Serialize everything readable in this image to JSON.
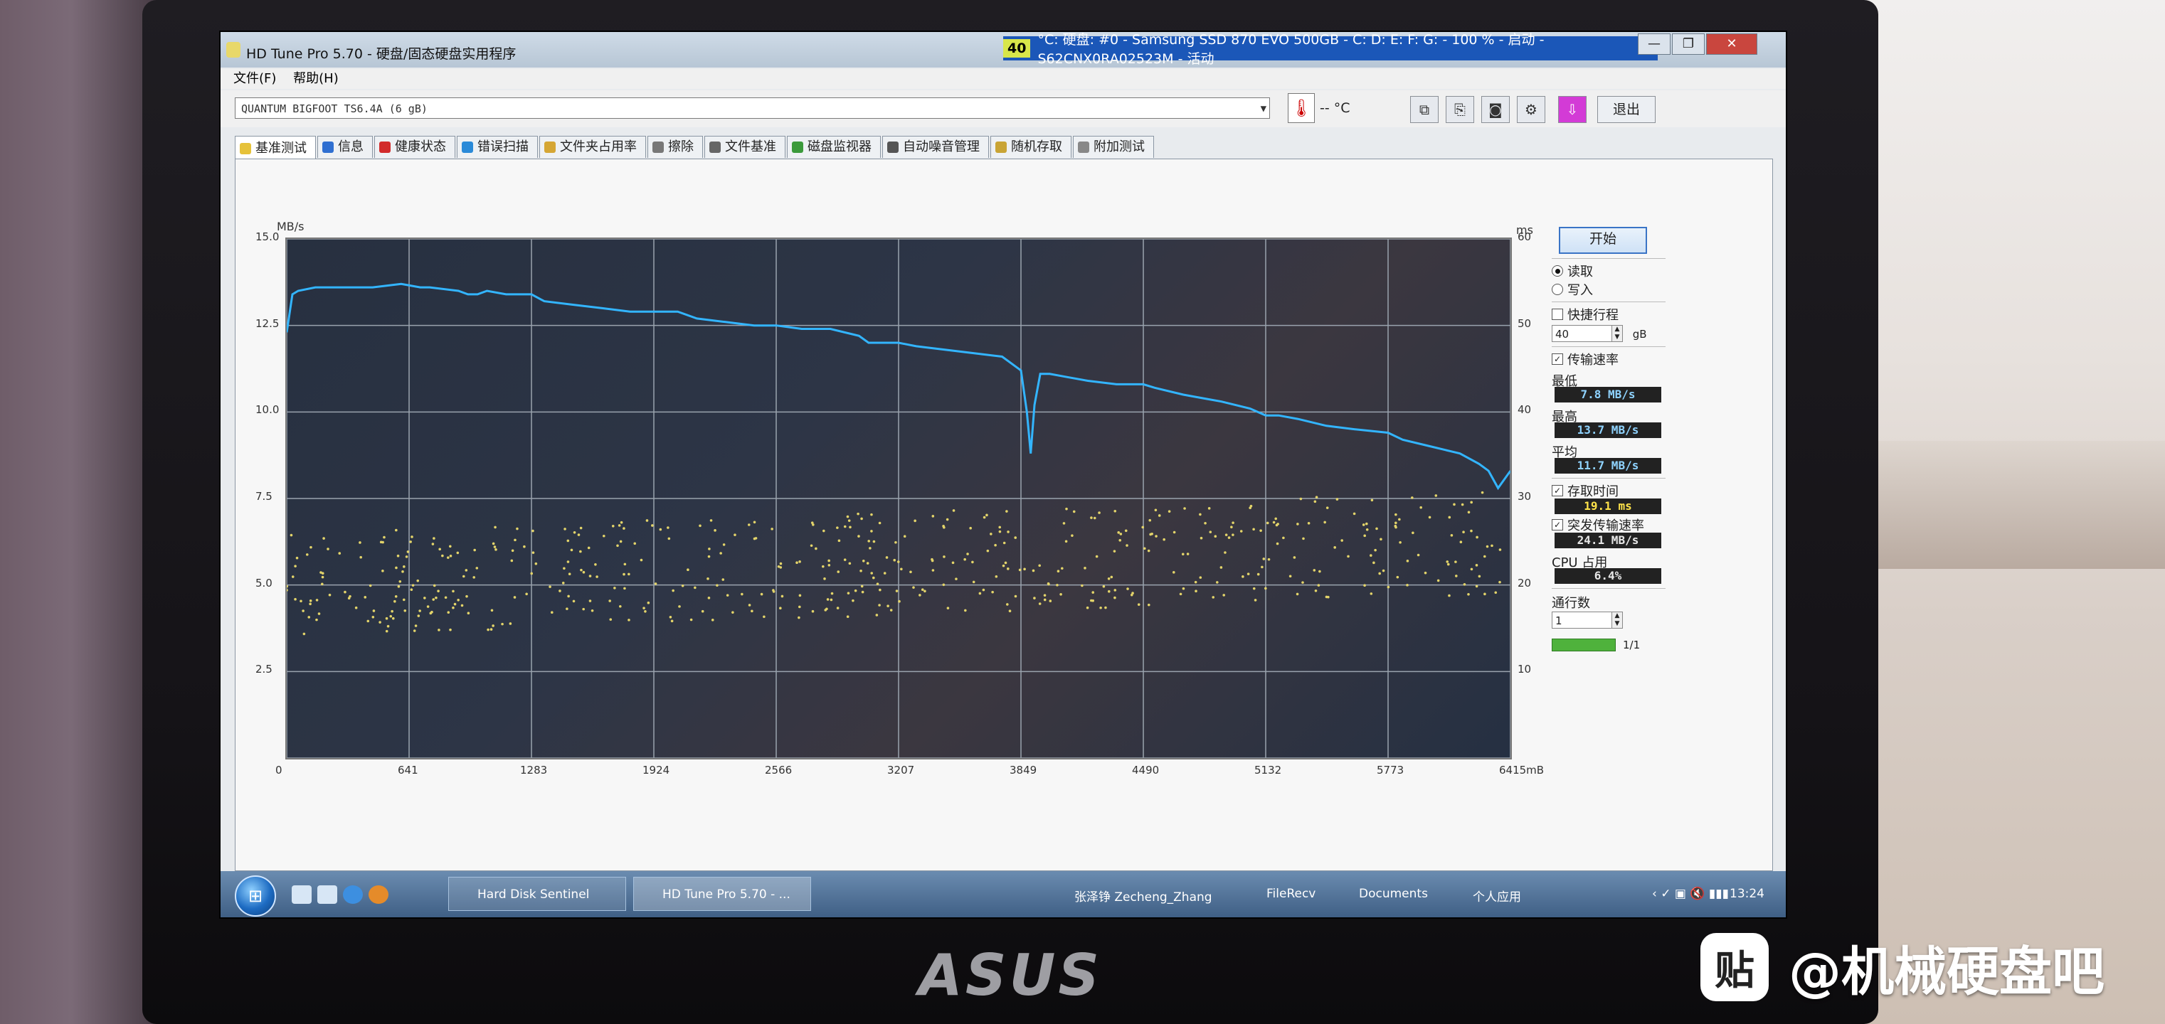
{
  "window": {
    "title": "HD Tune Pro 5.70 - 硬盘/固态硬盘实用程序",
    "status_temp": "40",
    "status_text": "°C: 硬盘: #0 - Samsung SSD 870 EVO 500GB - C: D: E: F: G: - 100 % - 启动 - S62CNX0RA02523M - 活动",
    "min_btn": "—",
    "max_btn": "❐",
    "close_btn": "✕"
  },
  "menu": {
    "file": "文件(F)",
    "help": "帮助(H)"
  },
  "toolbar": {
    "drive": "QUANTUM BIGFOOT TS6.4A (6 gB)",
    "temp": "-- °C",
    "exit": "退出"
  },
  "tabs": [
    {
      "label": "基准测试",
      "color": "#e6c23a"
    },
    {
      "label": "信息",
      "color": "#2f6fd1"
    },
    {
      "label": "健康状态",
      "color": "#d22b2b"
    },
    {
      "label": "错误扫描",
      "color": "#2a8ad8"
    },
    {
      "label": "文件夹占用率",
      "color": "#d5a634"
    },
    {
      "label": "擦除",
      "color": "#777777"
    },
    {
      "label": "文件基准",
      "color": "#666666"
    },
    {
      "label": "磁盘监视器",
      "color": "#3b9a3b"
    },
    {
      "label": "自动噪音管理",
      "color": "#555555"
    },
    {
      "label": "随机存取",
      "color": "#c9a435"
    },
    {
      "label": "附加测试",
      "color": "#888888"
    }
  ],
  "side": {
    "start": "开始",
    "read": "读取",
    "write": "写入",
    "short_stroke": "快捷行程",
    "short_value": "40",
    "short_unit": "gB",
    "transfer_rate": "传输速率",
    "min_label": "最低",
    "min_value": "7.8 MB/s",
    "max_label": "最高",
    "max_value": "13.7 MB/s",
    "avg_label": "平均",
    "avg_value": "11.7 MB/s",
    "access_time": "存取时间",
    "access_value": "19.1 ms",
    "burst_rate": "突发传输速率",
    "burst_value": "24.1 MB/s",
    "cpu_label": "CPU 占用",
    "cpu_value": "6.4%",
    "passes_label": "通行数",
    "passes_value": "1",
    "progress_text": "1/1",
    "progress_fraction": 1.0
  },
  "chart_data": {
    "type": "line",
    "ylabel": "MB/s",
    "ylabel_right": "ms",
    "xunit": "mB",
    "yticks": [
      "15.0",
      "12.5",
      "10.0",
      "7.5",
      "5.0",
      "2.5"
    ],
    "yticks_right": [
      "60",
      "50",
      "40",
      "30",
      "20",
      "10"
    ],
    "xticks": [
      "0",
      "641",
      "1283",
      "1924",
      "2566",
      "3207",
      "3849",
      "4490",
      "5132",
      "5773",
      "6415mB"
    ],
    "ylim": [
      0,
      15
    ],
    "ylim_right": [
      0,
      60
    ],
    "xlim": [
      0,
      6415
    ],
    "series": [
      {
        "color": "#33b5ff",
        "x": [
          0,
          30,
          60,
          150,
          300,
          450,
          600,
          700,
          750,
          900,
          950,
          1000,
          1050,
          1150,
          1283,
          1350,
          1500,
          1650,
          1800,
          1924,
          2050,
          2150,
          2300,
          2450,
          2566,
          2700,
          2850,
          3000,
          3050,
          3207,
          3300,
          3450,
          3600,
          3750,
          3849,
          3880,
          3900,
          3920,
          3950,
          4000,
          4100,
          4200,
          4350,
          4490,
          4550,
          4700,
          4800,
          4900,
          5050,
          5132,
          5200,
          5300,
          5450,
          5600,
          5773,
          5850,
          6000,
          6150,
          6250,
          6300,
          6350,
          6415
        ],
        "values": [
          12.3,
          13.4,
          13.5,
          13.6,
          13.6,
          13.6,
          13.7,
          13.6,
          13.6,
          13.5,
          13.4,
          13.4,
          13.5,
          13.4,
          13.4,
          13.2,
          13.1,
          13.0,
          12.9,
          12.9,
          12.9,
          12.7,
          12.6,
          12.5,
          12.5,
          12.4,
          12.4,
          12.2,
          12.0,
          12.0,
          11.9,
          11.8,
          11.7,
          11.6,
          11.2,
          10.0,
          8.8,
          10.2,
          11.1,
          11.1,
          11.0,
          10.9,
          10.8,
          10.8,
          10.7,
          10.5,
          10.4,
          10.3,
          10.1,
          9.9,
          9.9,
          9.8,
          9.6,
          9.5,
          9.4,
          9.2,
          9.0,
          8.8,
          8.5,
          8.3,
          7.8,
          8.3
        ]
      }
    ],
    "access_points_ms": "scatter of ~0–32 ms yellow dots across full range"
  },
  "taskbar": {
    "task1": "Hard Disk Sentinel",
    "task2": "HD Tune Pro 5.70 - ...",
    "user": "张泽铮 Zecheng_Zhang",
    "f1": "FileRecv",
    "f2": "Documents",
    "f3": "个人应用",
    "clock": "13:24"
  },
  "device": {
    "brand": "ASUS"
  },
  "watermark": {
    "logo": "贴",
    "text": "@机械硬盘吧"
  }
}
